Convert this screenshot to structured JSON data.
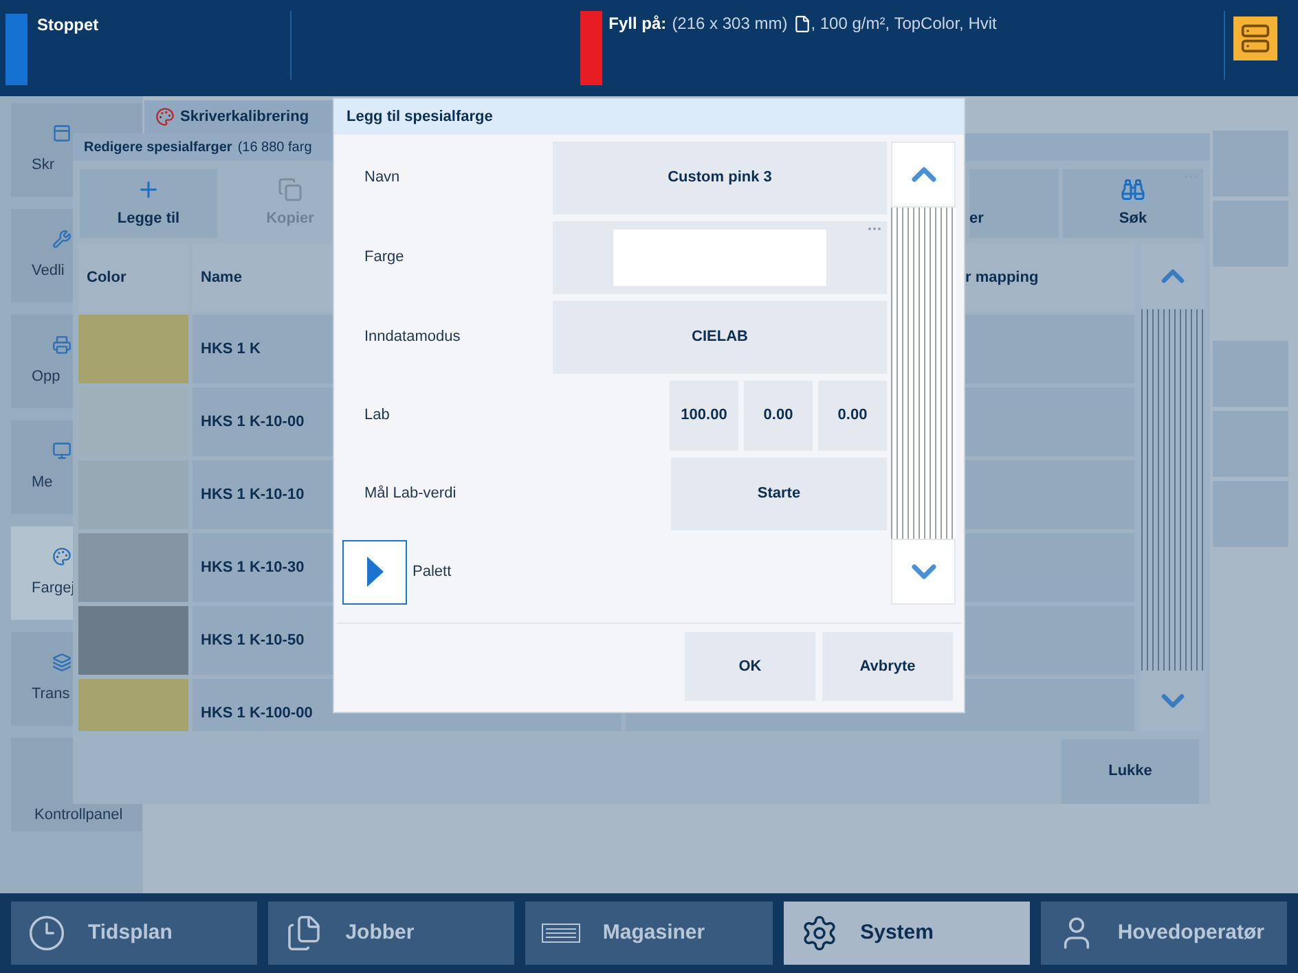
{
  "status_bar": {
    "state": "Stoppet",
    "fill_label": "Fyll på:",
    "fill_size": "(216 x 303 mm)",
    "fill_details": ", 100 g/m², TopColor, Hvit"
  },
  "sidebar": {
    "items": [
      {
        "label": "Skr",
        "selected": false
      },
      {
        "label": "Vedli",
        "selected": false
      },
      {
        "label": "Opp",
        "selected": false
      },
      {
        "label": "Me",
        "selected": false
      },
      {
        "label": "Fargej",
        "selected": true
      },
      {
        "label": "Trans",
        "selected": false
      },
      {
        "label": "Kontrollpanel",
        "selected": false
      }
    ]
  },
  "back_tab": {
    "label": "Skriverkalibrering"
  },
  "panel": {
    "title": "Redigere spesialfarger",
    "count": "(16 880 farg",
    "toolbar": [
      {
        "label": "Legge til",
        "disabled": false
      },
      {
        "label": "Kopier",
        "disabled": true
      }
    ],
    "toolbar_right": [
      {
        "label": "er",
        "disabled": false
      },
      {
        "label": "Søk",
        "disabled": false
      }
    ],
    "columns": [
      "Color",
      "Name",
      "r mapping"
    ],
    "rows": [
      {
        "color": "#a6a46c",
        "name": "HKS 1 K"
      },
      {
        "color": "#9fb0bb",
        "name": "HKS 1 K-10-00"
      },
      {
        "color": "#98a9b6",
        "name": "HKS 1 K-10-10"
      },
      {
        "color": "#8595a3",
        "name": "HKS 1 K-10-30"
      },
      {
        "color": "#6b7b8a",
        "name": "HKS 1 K-10-50"
      },
      {
        "color": "#a6a46c",
        "name": "HKS 1 K-100-00"
      }
    ],
    "close": "Lukke"
  },
  "dialog": {
    "title": "Legg til spesialfarge",
    "rows": [
      {
        "kind": "text",
        "label": "Navn",
        "value": "Custom pink 3"
      },
      {
        "kind": "swatch",
        "label": "Farge",
        "color": "#ffffff"
      },
      {
        "kind": "select",
        "label": "Inndatamodus",
        "value": "CIELAB"
      },
      {
        "kind": "triple",
        "label": "Lab",
        "values": [
          "100.00",
          "0.00",
          "0.00"
        ]
      },
      {
        "kind": "action",
        "label": "Mål Lab-verdi",
        "value": "Starte"
      },
      {
        "kind": "expander",
        "label": "Palett",
        "expanded": false
      }
    ],
    "buttons": [
      "OK",
      "Avbryte"
    ]
  },
  "nav": [
    {
      "label": "Tidsplan",
      "selected": false
    },
    {
      "label": "Jobber",
      "selected": false
    },
    {
      "label": "Magasiner",
      "selected": false
    },
    {
      "label": "System",
      "selected": true
    },
    {
      "label": "Hovedoperatør",
      "selected": false
    }
  ]
}
